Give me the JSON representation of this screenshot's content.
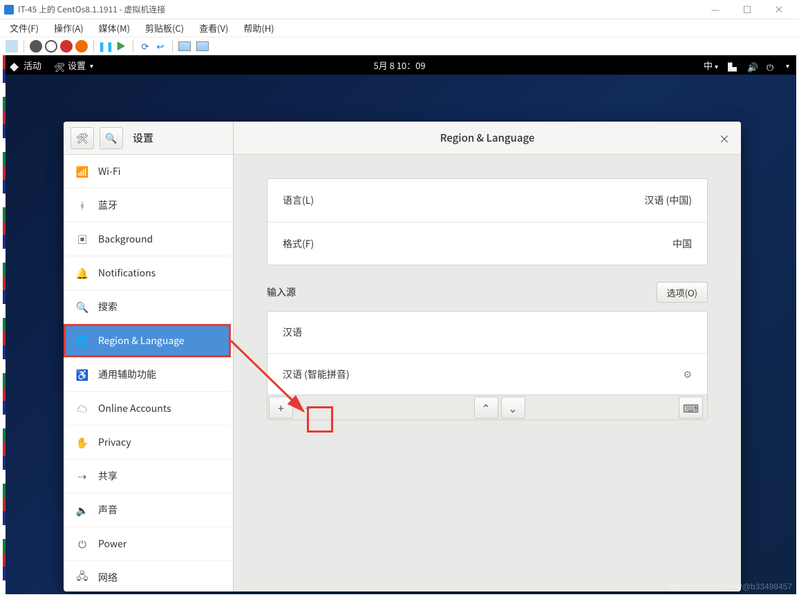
{
  "host": {
    "title": "IT-45 上的 CentOs8.1.1911 - 虚拟机连接",
    "menus": [
      "文件(F)",
      "操作(A)",
      "媒体(M)",
      "剪贴板(C)",
      "查看(V)",
      "帮助(H)"
    ],
    "winbtns": {
      "min": "—",
      "max": "☐",
      "close": "×"
    }
  },
  "gnome": {
    "activities": "活动",
    "app": "设置",
    "clock": "5月 8 10：09",
    "ime": "中",
    "caret": "▾"
  },
  "settings": {
    "headerTitle": "设置",
    "panelTitle": "Region & Language",
    "close": "×",
    "sidebar": [
      {
        "icon": "wifi",
        "label": "Wi-Fi"
      },
      {
        "icon": "bluetooth",
        "label": "蓝牙"
      },
      {
        "icon": "background",
        "label": "Background"
      },
      {
        "icon": "bell",
        "label": "Notifications"
      },
      {
        "icon": "search",
        "label": "搜索"
      },
      {
        "icon": "globe",
        "label": "Region & Language",
        "active": true
      },
      {
        "icon": "accessibility",
        "label": "通用辅助功能"
      },
      {
        "icon": "accounts",
        "label": "Online Accounts"
      },
      {
        "icon": "privacy",
        "label": "Privacy"
      },
      {
        "icon": "share",
        "label": "共享"
      },
      {
        "icon": "sound",
        "label": "声音"
      },
      {
        "icon": "power",
        "label": "Power"
      },
      {
        "icon": "network",
        "label": "网络"
      }
    ],
    "language": {
      "label": "语言(L)",
      "value": "汉语 (中国)"
    },
    "formats": {
      "label": "格式(F)",
      "value": "中国"
    },
    "inputSources": {
      "header": "输入源",
      "optionsBtn": "选项(O)",
      "items": [
        {
          "label": "汉语"
        },
        {
          "label": "汉语 (智能拼音)",
          "hasPrefs": true
        }
      ],
      "toolbar": {
        "add": "+",
        "remove": "−",
        "up": "⌃",
        "down": "⌄",
        "keyboard": "⌨"
      }
    }
  },
  "watermark": "https://blog.csdn.net/@b33498457",
  "iconGlyphs": {
    "wifi": "📶",
    "bluetooth": "ᚼ",
    "background": "▣",
    "bell": "🔔",
    "search": "🔍",
    "globe": "🌐",
    "accessibility": "♿",
    "accounts": "☁",
    "privacy": "✋",
    "share": "⇢",
    "sound": "🔈",
    "power": "⏻",
    "network": "🖧",
    "tools": "🛠",
    "gear": "⚙"
  }
}
